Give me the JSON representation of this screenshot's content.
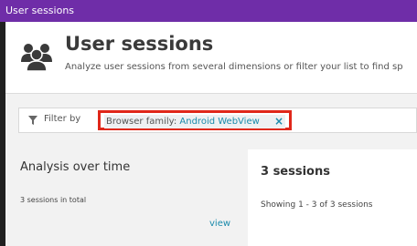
{
  "topbar": {
    "title": "User sessions"
  },
  "header": {
    "icon": "users-group-icon",
    "title": "User sessions",
    "subtitle": "Analyze user sessions from several dimensions or filter your list to find sp"
  },
  "filter": {
    "icon": "filter-funnel-icon",
    "label": "Filter by",
    "chip": {
      "key": "Browser family:",
      "value": "Android WebView",
      "close_icon": "close-x-icon"
    },
    "highlight_color": "#e0271a"
  },
  "analysis": {
    "title": "Analysis over time",
    "total": "3 sessions in total",
    "view_link": "view"
  },
  "sessions_panel": {
    "title": "3 sessions",
    "showing": "Showing 1 - 3 of 3 sessions"
  },
  "colors": {
    "topbar": "#6f2da8",
    "accent": "#1a8aab"
  }
}
